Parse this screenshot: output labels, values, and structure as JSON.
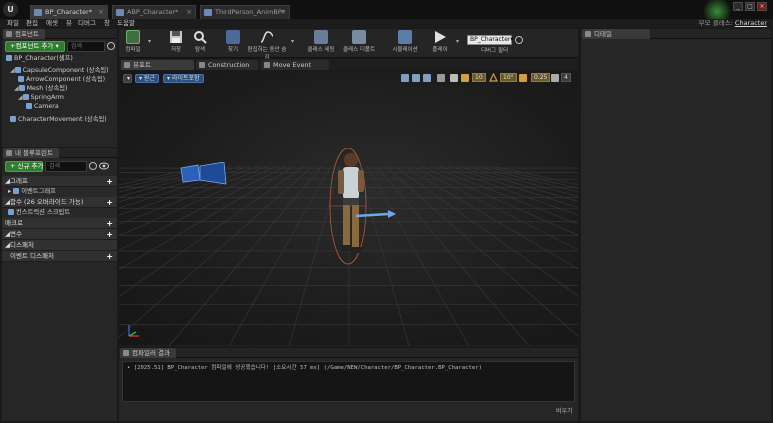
{
  "title_bar": {
    "tabs": [
      {
        "label": "BP_Character*"
      },
      {
        "label": "ABP_Character*"
      },
      {
        "label": "ThirdPerson_AnimBP*"
      }
    ]
  },
  "menu": {
    "items": [
      "파일",
      "편집",
      "애셋",
      "뷰",
      "디버그",
      "창",
      "도움말"
    ],
    "right_prefix": "부모 클래스:",
    "right_link": "Character"
  },
  "components_panel": {
    "tab": "컴포넌트",
    "add_button": "+컴포넌트 추가 ▾",
    "search_placeholder": "검색",
    "items": [
      "BP_Character(셀프)",
      "CapsuleComponent (상속됨)",
      "ArrowComponent (상속됨)",
      "Mesh (상속됨)",
      "SpringArm",
      "Camera",
      "CharacterMovement (상속됨)"
    ]
  },
  "my_blueprint_panel": {
    "tab": "내 블루프린트",
    "add_button": "+ 신규 추가 ▾",
    "search_placeholder": "검색",
    "categories": [
      {
        "label": "그래프"
      },
      {
        "sub": "이벤트그래프"
      },
      {
        "label": "함수 (26 오버라이드 가능)"
      },
      {
        "sub": "컨스트럭션 스크립트"
      },
      {
        "label": "매크로"
      },
      {
        "label": "변수"
      },
      {
        "label": "디스패처"
      },
      {
        "sub": "이벤트 디스패처"
      }
    ]
  },
  "toolbar": {
    "buttons": [
      "컴파일",
      "저장",
      "탐색",
      "찾기",
      "편집하는 동안 숨김",
      "클래스 세팅",
      "클래스 디폴트",
      "시뮬레이션",
      "플레이"
    ],
    "debug_value": "BP_Character▾",
    "debug_label": "디버그 필터"
  },
  "viewport_tabs": [
    "뷰포트",
    "Construction Scrip",
    "Move Event"
  ],
  "viewport": {
    "perspective": "원근",
    "lit": "라이트포함",
    "grid_snap": "10",
    "rot_snap": "10°",
    "scale_snap": "0.25",
    "cam_speed": "4"
  },
  "details_panel": {
    "tab": "디테일"
  },
  "compiler_results": {
    "tab": "컴파일러 결과",
    "log": "• [2025.51] BP_Character 컴파일에 성공했습니다! [소요시간 57 ms] (/Game/NEW/Character/BP_Character.BP_Character)",
    "clear": "비우기"
  }
}
